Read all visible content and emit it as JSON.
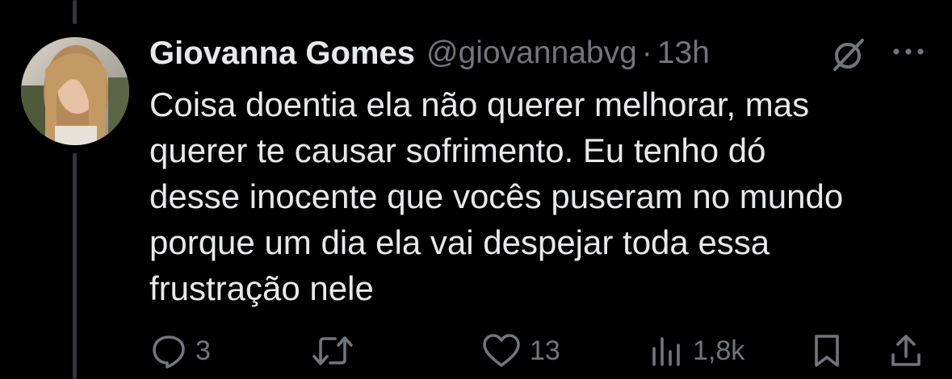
{
  "tweet": {
    "author": {
      "display_name": "Giovanna Gomes",
      "handle": "@giovannabvg",
      "avatar_icon": "profile-photo"
    },
    "separator": "·",
    "time": "13h",
    "text": "Coisa doentia ela não querer melhorar, mas\nquerer te causar sofrimento. Eu tenho dó\ndesse inocente que vocês puseram no mundo\nporque um dia ela vai despejar toda essa\nfrustração nele",
    "actions": {
      "reply_count": "3",
      "retweet_count": "",
      "like_count": "13",
      "views_count": "1,8k"
    },
    "icons": {
      "grok": "grok-icon",
      "more": "more-icon",
      "reply": "reply-icon",
      "retweet": "retweet-icon",
      "like": "heart-icon",
      "views": "views-icon",
      "bookmark": "bookmark-icon",
      "share": "share-icon"
    }
  },
  "colors": {
    "background": "#000000",
    "primary_text": "#e7e9ea",
    "secondary_text": "#71767b",
    "thread_line": "#333639"
  }
}
